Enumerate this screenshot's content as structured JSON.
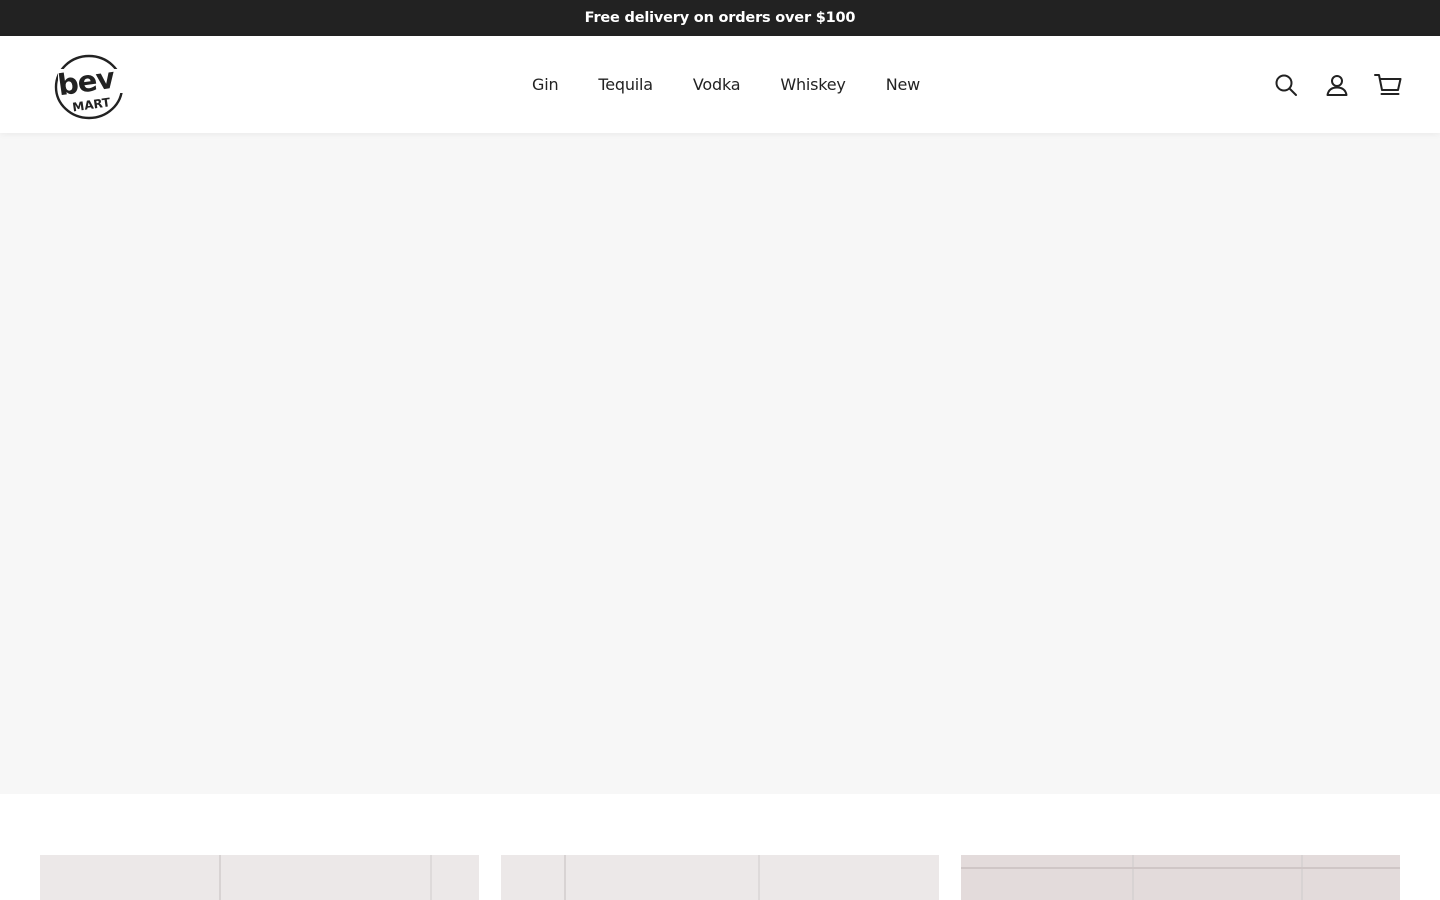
{
  "announcement": {
    "text": "Free delivery on orders over $100"
  },
  "brand": {
    "logo_text_main": "bev",
    "logo_text_sub": "MART"
  },
  "nav": {
    "items": [
      {
        "label": "Gin"
      },
      {
        "label": "Tequila"
      },
      {
        "label": "Vodka"
      },
      {
        "label": "Whiskey"
      },
      {
        "label": "New"
      }
    ]
  },
  "icons": {
    "search": "search-icon",
    "account": "user-icon",
    "cart": "cart-icon"
  },
  "colors": {
    "announcement_bg": "#222222",
    "hero_bg": "#f7f7f7",
    "text": "#222222"
  },
  "collections": {
    "cards": [
      {
        "name": "collection-card-1"
      },
      {
        "name": "collection-card-2"
      },
      {
        "name": "collection-card-3"
      }
    ]
  }
}
